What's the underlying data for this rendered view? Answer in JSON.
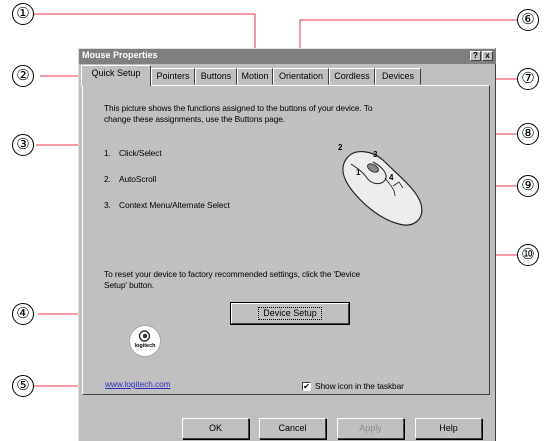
{
  "window": {
    "title": "Mouse Properties",
    "help_button": "?",
    "close_button": "x"
  },
  "tabs": [
    "Quick Setup",
    "Pointers",
    "Buttons",
    "Motion",
    "Orientation",
    "Cordless",
    "Devices"
  ],
  "quick_setup": {
    "intro_line1": "This picture shows the functions assigned to the buttons of your device. To",
    "intro_line2": "change these assignments, use the Buttons page.",
    "functions": [
      {
        "num": "1.",
        "label": "Click/Select"
      },
      {
        "num": "2.",
        "label": "AutoScroll"
      },
      {
        "num": "3.",
        "label": "Context Menu/Alternate Select"
      }
    ],
    "mouse_labels": [
      "1",
      "2",
      "3",
      "4"
    ],
    "reset_line1": "To reset your device to factory recommended settings, click the 'Device",
    "reset_line2": "Setup' button.",
    "device_setup_button": "Device Setup",
    "logo_text": "logitech",
    "website_link": "www.logitech.com",
    "show_icon_checkbox": {
      "label": "Show icon in the taskbar",
      "checked": true,
      "mark": "✔"
    }
  },
  "footer_buttons": {
    "ok": "OK",
    "cancel": "Cancel",
    "apply": "Apply",
    "help": "Help"
  },
  "callouts": [
    "①",
    "②",
    "③",
    "④",
    "⑤",
    "⑥",
    "⑦",
    "⑧",
    "⑨",
    "⑩"
  ]
}
